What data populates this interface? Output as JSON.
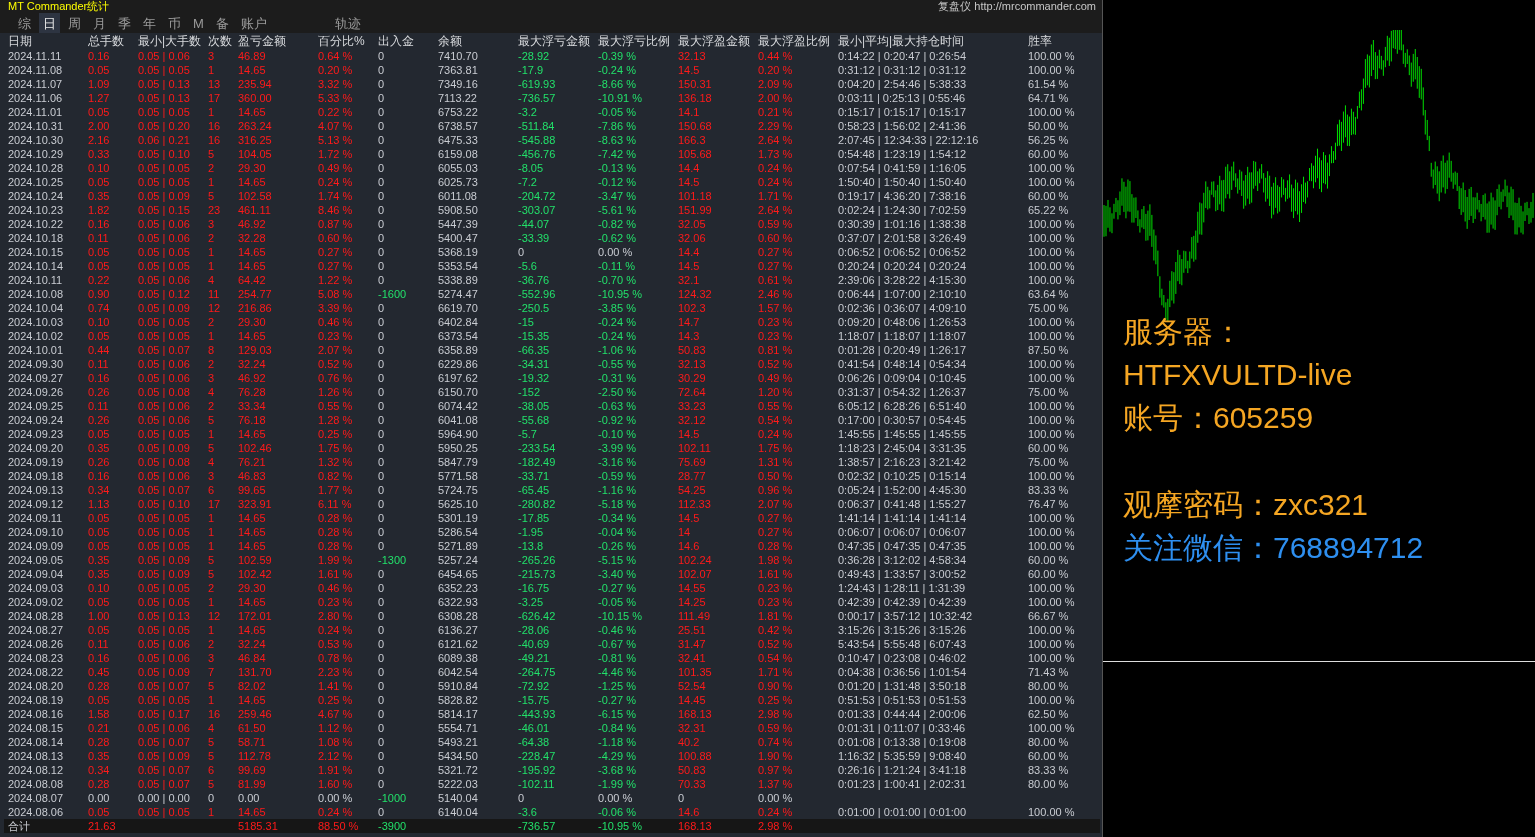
{
  "window": {
    "title": "MT Commander统计",
    "link": "复盘仪 http://mrcommander.com"
  },
  "tabs": [
    {
      "label": "综",
      "selected": false
    },
    {
      "label": "日",
      "selected": true
    },
    {
      "label": "周",
      "selected": false
    },
    {
      "label": "月",
      "selected": false
    },
    {
      "label": "季",
      "selected": false
    },
    {
      "label": "年",
      "selected": false
    },
    {
      "label": "币",
      "selected": false
    },
    {
      "label": "M",
      "selected": false
    },
    {
      "label": "备",
      "selected": false
    },
    {
      "label": "账户",
      "selected": false
    }
  ],
  "trail_tab": {
    "label": "轨迹",
    "selected": false
  },
  "table": {
    "columns": [
      "日期",
      "总手数",
      "最小|大手数",
      "次数",
      "盈亏金额",
      "百分比%",
      "出入金",
      "余额",
      "最大浮亏金额",
      "最大浮亏比例",
      "最大浮盈金额",
      "最大浮盈比例",
      "最小|平均|最大持仓时间",
      "胜率"
    ],
    "rows": [
      {
        "cells": [
          "2024.11.11",
          "0.16",
          "0.05 | 0.06",
          "3",
          "46.89",
          "0.64 %",
          "0",
          "7410.70",
          "-28.92",
          "-0.39 %",
          "32.13",
          "0.44 %",
          "0:14:22 | 0:20:47 | 0:26:54",
          "100.00 %"
        ],
        "trading": true,
        "deposit": false,
        "float_loss": true
      },
      {
        "cells": [
          "2024.11.08",
          "0.05",
          "0.05 | 0.05",
          "1",
          "14.65",
          "0.20 %",
          "0",
          "7363.81",
          "-17.9",
          "-0.24 %",
          "14.5",
          "0.20 %",
          "0:31:12 | 0:31:12 | 0:31:12",
          "100.00 %"
        ],
        "trading": true,
        "deposit": false,
        "float_loss": true
      },
      {
        "cells": [
          "2024.11.07",
          "1.09",
          "0.05 | 0.13",
          "13",
          "235.94",
          "3.32 %",
          "0",
          "7349.16",
          "-619.93",
          "-8.66 %",
          "150.31",
          "2.09 %",
          "0:04:20 | 2:54:46 | 5:38:33",
          "61.54 %"
        ],
        "trading": true,
        "deposit": false,
        "float_loss": true
      },
      {
        "cells": [
          "2024.11.06",
          "1.27",
          "0.05 | 0.13",
          "17",
          "360.00",
          "5.33 %",
          "0",
          "7113.22",
          "-736.57",
          "-10.91 %",
          "136.18",
          "2.00 %",
          "0:03:11 | 0:25:13 | 0:55:46",
          "64.71 %"
        ],
        "trading": true,
        "deposit": false,
        "float_loss": true
      },
      {
        "cells": [
          "2024.11.01",
          "0.05",
          "0.05 | 0.05",
          "1",
          "14.65",
          "0.22 %",
          "0",
          "6753.22",
          "-3.2",
          "-0.05 %",
          "14.1",
          "0.21 %",
          "0:15:17 | 0:15:17 | 0:15:17",
          "100.00 %"
        ],
        "trading": true,
        "deposit": false,
        "float_loss": true
      },
      {
        "cells": [
          "2024.10.31",
          "2.00",
          "0.05 | 0.20",
          "16",
          "263.24",
          "4.07 %",
          "0",
          "6738.57",
          "-511.84",
          "-7.86 %",
          "150.68",
          "2.29 %",
          "0:58:23 | 1:56:02 | 2:41:36",
          "50.00 %"
        ],
        "trading": true,
        "deposit": false,
        "float_loss": true
      },
      {
        "cells": [
          "2024.10.30",
          "2.16",
          "0.06 | 0.21",
          "16",
          "316.25",
          "5.13 %",
          "0",
          "6475.33",
          "-545.88",
          "-8.63 %",
          "166.3",
          "2.64 %",
          "2:07:45 | 12:34:33 | 22:12:16",
          "56.25 %"
        ],
        "trading": true,
        "deposit": false,
        "float_loss": true
      },
      {
        "cells": [
          "2024.10.29",
          "0.33",
          "0.05 | 0.10",
          "5",
          "104.05",
          "1.72 %",
          "0",
          "6159.08",
          "-456.76",
          "-7.42 %",
          "105.68",
          "1.73 %",
          "0:54:48 | 1:23:19 | 1:54:12",
          "60.00 %"
        ],
        "trading": true,
        "deposit": false,
        "float_loss": true
      },
      {
        "cells": [
          "2024.10.28",
          "0.10",
          "0.05 | 0.05",
          "2",
          "29.30",
          "0.49 %",
          "0",
          "6055.03",
          "-8.05",
          "-0.13 %",
          "14.4",
          "0.24 %",
          "0:07:54 | 0:41:59 | 1:16:05",
          "100.00 %"
        ],
        "trading": true,
        "deposit": false,
        "float_loss": true
      },
      {
        "cells": [
          "2024.10.25",
          "0.05",
          "0.05 | 0.05",
          "1",
          "14.65",
          "0.24 %",
          "0",
          "6025.73",
          "-7.2",
          "-0.12 %",
          "14.5",
          "0.24 %",
          "1:50:40 | 1:50:40 | 1:50:40",
          "100.00 %"
        ],
        "trading": true,
        "deposit": false,
        "float_loss": true
      },
      {
        "cells": [
          "2024.10.24",
          "0.35",
          "0.05 | 0.09",
          "5",
          "102.58",
          "1.74 %",
          "0",
          "6011.08",
          "-204.72",
          "-3.47 %",
          "101.18",
          "1.71 %",
          "0:19:17 | 4:36:20 | 7:38:16",
          "60.00 %"
        ],
        "trading": true,
        "deposit": false,
        "float_loss": true
      },
      {
        "cells": [
          "2024.10.23",
          "1.82",
          "0.05 | 0.15",
          "23",
          "461.11",
          "8.46 %",
          "0",
          "5908.50",
          "-303.07",
          "-5.61 %",
          "151.99",
          "2.64 %",
          "0:02:24 | 1:24:30 | 7:02:59",
          "65.22 %"
        ],
        "trading": true,
        "deposit": false,
        "float_loss": true
      },
      {
        "cells": [
          "2024.10.22",
          "0.16",
          "0.05 | 0.06",
          "3",
          "46.92",
          "0.87 %",
          "0",
          "5447.39",
          "-44.07",
          "-0.82 %",
          "32.05",
          "0.59 %",
          "0:30:39 | 1:01:16 | 1:38:38",
          "100.00 %"
        ],
        "trading": true,
        "deposit": false,
        "float_loss": true
      },
      {
        "cells": [
          "2024.10.18",
          "0.11",
          "0.05 | 0.06",
          "2",
          "32.28",
          "0.60 %",
          "0",
          "5400.47",
          "-33.39",
          "-0.62 %",
          "32.06",
          "0.60 %",
          "0:37:07 | 2:01:58 | 3:26:49",
          "100.00 %"
        ],
        "trading": true,
        "deposit": false,
        "float_loss": true
      },
      {
        "cells": [
          "2024.10.15",
          "0.05",
          "0.05 | 0.05",
          "1",
          "14.65",
          "0.27 %",
          "0",
          "5368.19",
          "0",
          "0.00 %",
          "14.4",
          "0.27 %",
          "0:06:52 | 0:06:52 | 0:06:52",
          "100.00 %"
        ],
        "trading": true,
        "deposit": false,
        "float_loss": false
      },
      {
        "cells": [
          "2024.10.14",
          "0.05",
          "0.05 | 0.05",
          "1",
          "14.65",
          "0.27 %",
          "0",
          "5353.54",
          "-5.6",
          "-0.11 %",
          "14.5",
          "0.27 %",
          "0:20:24 | 0:20:24 | 0:20:24",
          "100.00 %"
        ],
        "trading": true,
        "deposit": false,
        "float_loss": true
      },
      {
        "cells": [
          "2024.10.11",
          "0.22",
          "0.05 | 0.06",
          "4",
          "64.42",
          "1.22 %",
          "0",
          "5338.89",
          "-36.76",
          "-0.70 %",
          "32.1",
          "0.61 %",
          "2:39:06 | 3:28:22 | 4:15:30",
          "100.00 %"
        ],
        "trading": true,
        "deposit": false,
        "float_loss": true
      },
      {
        "cells": [
          "2024.10.08",
          "0.90",
          "0.05 | 0.12",
          "11",
          "254.77",
          "5.08 %",
          "-1600",
          "5274.47",
          "-552.96",
          "-10.95 %",
          "124.32",
          "2.46 %",
          "0:06:44 | 1:07:00 | 2:10:10",
          "63.64 %"
        ],
        "trading": true,
        "deposit": true,
        "float_loss": true
      },
      {
        "cells": [
          "2024.10.04",
          "0.74",
          "0.05 | 0.09",
          "12",
          "216.86",
          "3.39 %",
          "0",
          "6619.70",
          "-250.5",
          "-3.85 %",
          "102.3",
          "1.57 %",
          "0:02:36 | 0:36:07 | 4:09:10",
          "75.00 %"
        ],
        "trading": true,
        "deposit": false,
        "float_loss": true
      },
      {
        "cells": [
          "2024.10.03",
          "0.10",
          "0.05 | 0.05",
          "2",
          "29.30",
          "0.46 %",
          "0",
          "6402.84",
          "-15",
          "-0.24 %",
          "14.7",
          "0.23 %",
          "0:09:20 | 0:48:06 | 1:26:53",
          "100.00 %"
        ],
        "trading": true,
        "deposit": false,
        "float_loss": true
      },
      {
        "cells": [
          "2024.10.02",
          "0.05",
          "0.05 | 0.05",
          "1",
          "14.65",
          "0.23 %",
          "0",
          "6373.54",
          "-15.35",
          "-0.24 %",
          "14.3",
          "0.23 %",
          "1:18:07 | 1:18:07 | 1:18:07",
          "100.00 %"
        ],
        "trading": true,
        "deposit": false,
        "float_loss": true
      },
      {
        "cells": [
          "2024.10.01",
          "0.44",
          "0.05 | 0.07",
          "8",
          "129.03",
          "2.07 %",
          "0",
          "6358.89",
          "-66.35",
          "-1.06 %",
          "50.83",
          "0.81 %",
          "0:01:28 | 0:20:49 | 1:26:17",
          "87.50 %"
        ],
        "trading": true,
        "deposit": false,
        "float_loss": true
      },
      {
        "cells": [
          "2024.09.30",
          "0.11",
          "0.05 | 0.06",
          "2",
          "32.24",
          "0.52 %",
          "0",
          "6229.86",
          "-34.31",
          "-0.55 %",
          "32.13",
          "0.52 %",
          "0:41:54 | 0:48:14 | 0:54:34",
          "100.00 %"
        ],
        "trading": true,
        "deposit": false,
        "float_loss": true
      },
      {
        "cells": [
          "2024.09.27",
          "0.16",
          "0.05 | 0.06",
          "3",
          "46.92",
          "0.76 %",
          "0",
          "6197.62",
          "-19.32",
          "-0.31 %",
          "30.29",
          "0.49 %",
          "0:06:26 | 0:09:04 | 0:10:45",
          "100.00 %"
        ],
        "trading": true,
        "deposit": false,
        "float_loss": true
      },
      {
        "cells": [
          "2024.09.26",
          "0.26",
          "0.05 | 0.08",
          "4",
          "76.28",
          "1.26 %",
          "0",
          "6150.70",
          "-152",
          "-2.50 %",
          "72.64",
          "1.20 %",
          "0:31:37 | 0:54:32 | 1:26:37",
          "75.00 %"
        ],
        "trading": true,
        "deposit": false,
        "float_loss": true
      },
      {
        "cells": [
          "2024.09.25",
          "0.11",
          "0.05 | 0.06",
          "2",
          "33.34",
          "0.55 %",
          "0",
          "6074.42",
          "-38.05",
          "-0.63 %",
          "33.23",
          "0.55 %",
          "6:05:12 | 6:28:26 | 6:51:40",
          "100.00 %"
        ],
        "trading": true,
        "deposit": false,
        "float_loss": true
      },
      {
        "cells": [
          "2024.09.24",
          "0.26",
          "0.05 | 0.06",
          "5",
          "76.18",
          "1.28 %",
          "0",
          "6041.08",
          "-55.68",
          "-0.92 %",
          "32.12",
          "0.54 %",
          "0:17:00 | 0:30:57 | 0:54:45",
          "100.00 %"
        ],
        "trading": true,
        "deposit": false,
        "float_loss": true
      },
      {
        "cells": [
          "2024.09.23",
          "0.05",
          "0.05 | 0.05",
          "1",
          "14.65",
          "0.25 %",
          "0",
          "5964.90",
          "-5.7",
          "-0.10 %",
          "14.5",
          "0.24 %",
          "1:45:55 | 1:45:55 | 1:45:55",
          "100.00 %"
        ],
        "trading": true,
        "deposit": false,
        "float_loss": true
      },
      {
        "cells": [
          "2024.09.20",
          "0.35",
          "0.05 | 0.09",
          "5",
          "102.46",
          "1.75 %",
          "0",
          "5950.25",
          "-233.54",
          "-3.99 %",
          "102.11",
          "1.75 %",
          "1:18:23 | 2:45:04 | 3:31:35",
          "60.00 %"
        ],
        "trading": true,
        "deposit": false,
        "float_loss": true
      },
      {
        "cells": [
          "2024.09.19",
          "0.26",
          "0.05 | 0.08",
          "4",
          "76.21",
          "1.32 %",
          "0",
          "5847.79",
          "-182.49",
          "-3.16 %",
          "75.69",
          "1.31 %",
          "1:38:57 | 2:16:23 | 3:21:42",
          "75.00 %"
        ],
        "trading": true,
        "deposit": false,
        "float_loss": true
      },
      {
        "cells": [
          "2024.09.18",
          "0.16",
          "0.05 | 0.06",
          "3",
          "46.83",
          "0.82 %",
          "0",
          "5771.58",
          "-33.71",
          "-0.59 %",
          "28.77",
          "0.50 %",
          "0:02:32 | 0:10:25 | 0:15:14",
          "100.00 %"
        ],
        "trading": true,
        "deposit": false,
        "float_loss": true
      },
      {
        "cells": [
          "2024.09.13",
          "0.34",
          "0.05 | 0.07",
          "6",
          "99.65",
          "1.77 %",
          "0",
          "5724.75",
          "-65.45",
          "-1.16 %",
          "54.25",
          "0.96 %",
          "0:05:24 | 1:52:00 | 4:45:30",
          "83.33 %"
        ],
        "trading": true,
        "deposit": false,
        "float_loss": true
      },
      {
        "cells": [
          "2024.09.12",
          "1.13",
          "0.05 | 0.10",
          "17",
          "323.91",
          "6.11 %",
          "0",
          "5625.10",
          "-280.82",
          "-5.18 %",
          "112.33",
          "2.07 %",
          "0:06:37 | 0:41:48 | 1:55:27",
          "76.47 %"
        ],
        "trading": true,
        "deposit": false,
        "float_loss": true
      },
      {
        "cells": [
          "2024.09.11",
          "0.05",
          "0.05 | 0.05",
          "1",
          "14.65",
          "0.28 %",
          "0",
          "5301.19",
          "-17.85",
          "-0.34 %",
          "14.5",
          "0.27 %",
          "1:41:14 | 1:41:14 | 1:41:14",
          "100.00 %"
        ],
        "trading": true,
        "deposit": false,
        "float_loss": true
      },
      {
        "cells": [
          "2024.09.10",
          "0.05",
          "0.05 | 0.05",
          "1",
          "14.65",
          "0.28 %",
          "0",
          "5286.54",
          "-1.95",
          "-0.04 %",
          "14",
          "0.27 %",
          "0:06:07 | 0:06:07 | 0:06:07",
          "100.00 %"
        ],
        "trading": true,
        "deposit": false,
        "float_loss": true
      },
      {
        "cells": [
          "2024.09.09",
          "0.05",
          "0.05 | 0.05",
          "1",
          "14.65",
          "0.28 %",
          "0",
          "5271.89",
          "-13.8",
          "-0.26 %",
          "14.6",
          "0.28 %",
          "0:47:35 | 0:47:35 | 0:47:35",
          "100.00 %"
        ],
        "trading": true,
        "deposit": false,
        "float_loss": true
      },
      {
        "cells": [
          "2024.09.05",
          "0.35",
          "0.05 | 0.09",
          "5",
          "102.59",
          "1.99 %",
          "-1300",
          "5257.24",
          "-265.26",
          "-5.15 %",
          "102.24",
          "1.98 %",
          "0:36:28 | 3:12:02 | 4:58:34",
          "60.00 %"
        ],
        "trading": true,
        "deposit": true,
        "float_loss": true
      },
      {
        "cells": [
          "2024.09.04",
          "0.35",
          "0.05 | 0.09",
          "5",
          "102.42",
          "1.61 %",
          "0",
          "6454.65",
          "-215.73",
          "-3.40 %",
          "102.07",
          "1.61 %",
          "0:49:43 | 1:33:57 | 3:00:52",
          "60.00 %"
        ],
        "trading": true,
        "deposit": false,
        "float_loss": true
      },
      {
        "cells": [
          "2024.09.03",
          "0.10",
          "0.05 | 0.05",
          "2",
          "29.30",
          "0.46 %",
          "0",
          "6352.23",
          "-16.75",
          "-0.27 %",
          "14.55",
          "0.23 %",
          "1:24:43 | 1:28:11 | 1:31:39",
          "100.00 %"
        ],
        "trading": true,
        "deposit": false,
        "float_loss": true
      },
      {
        "cells": [
          "2024.09.02",
          "0.05",
          "0.05 | 0.05",
          "1",
          "14.65",
          "0.23 %",
          "0",
          "6322.93",
          "-3.25",
          "-0.05 %",
          "14.25",
          "0.23 %",
          "0:42:39 | 0:42:39 | 0:42:39",
          "100.00 %"
        ],
        "trading": true,
        "deposit": false,
        "float_loss": true
      },
      {
        "cells": [
          "2024.08.28",
          "1.00",
          "0.05 | 0.13",
          "12",
          "172.01",
          "2.80 %",
          "0",
          "6308.28",
          "-626.42",
          "-10.15 %",
          "111.49",
          "1.81 %",
          "0:00:17 | 3:57:12 | 10:32:42",
          "66.67 %"
        ],
        "trading": true,
        "deposit": false,
        "float_loss": true
      },
      {
        "cells": [
          "2024.08.27",
          "0.05",
          "0.05 | 0.05",
          "1",
          "14.65",
          "0.24 %",
          "0",
          "6136.27",
          "-28.06",
          "-0.46 %",
          "25.51",
          "0.42 %",
          "3:15:26 | 3:15:26 | 3:15:26",
          "100.00 %"
        ],
        "trading": true,
        "deposit": false,
        "float_loss": true
      },
      {
        "cells": [
          "2024.08.26",
          "0.11",
          "0.05 | 0.06",
          "2",
          "32.24",
          "0.53 %",
          "0",
          "6121.62",
          "-40.69",
          "-0.67 %",
          "31.47",
          "0.52 %",
          "5:43:54 | 5:55:48 | 6:07:43",
          "100.00 %"
        ],
        "trading": true,
        "deposit": false,
        "float_loss": true
      },
      {
        "cells": [
          "2024.08.23",
          "0.16",
          "0.05 | 0.06",
          "3",
          "46.84",
          "0.78 %",
          "0",
          "6089.38",
          "-49.21",
          "-0.81 %",
          "32.41",
          "0.54 %",
          "0:10:47 | 0:23:08 | 0:46:02",
          "100.00 %"
        ],
        "trading": true,
        "deposit": false,
        "float_loss": true
      },
      {
        "cells": [
          "2024.08.22",
          "0.45",
          "0.05 | 0.09",
          "7",
          "131.70",
          "2.23 %",
          "0",
          "6042.54",
          "-264.75",
          "-4.46 %",
          "101.35",
          "1.71 %",
          "0:04:38 | 0:36:56 | 1:01:54",
          "71.43 %"
        ],
        "trading": true,
        "deposit": false,
        "float_loss": true
      },
      {
        "cells": [
          "2024.08.20",
          "0.28",
          "0.05 | 0.07",
          "5",
          "82.02",
          "1.41 %",
          "0",
          "5910.84",
          "-72.92",
          "-1.25 %",
          "52.54",
          "0.90 %",
          "0:01:20 | 1:31:48 | 3:50:18",
          "80.00 %"
        ],
        "trading": true,
        "deposit": false,
        "float_loss": true
      },
      {
        "cells": [
          "2024.08.19",
          "0.05",
          "0.05 | 0.05",
          "1",
          "14.65",
          "0.25 %",
          "0",
          "5828.82",
          "-15.75",
          "-0.27 %",
          "14.45",
          "0.25 %",
          "0:51:53 | 0:51:53 | 0:51:53",
          "100.00 %"
        ],
        "trading": true,
        "deposit": false,
        "float_loss": true
      },
      {
        "cells": [
          "2024.08.16",
          "1.58",
          "0.05 | 0.17",
          "16",
          "259.46",
          "4.67 %",
          "0",
          "5814.17",
          "-443.93",
          "-6.15 %",
          "168.13",
          "2.98 %",
          "0:01:33 | 0:44:44 | 2:00:06",
          "62.50 %"
        ],
        "trading": true,
        "deposit": false,
        "float_loss": true
      },
      {
        "cells": [
          "2024.08.15",
          "0.21",
          "0.05 | 0.06",
          "4",
          "61.50",
          "1.12 %",
          "0",
          "5554.71",
          "-46.01",
          "-0.84 %",
          "32.31",
          "0.59 %",
          "0:01:31 | 0:11:07 | 0:33:46",
          "100.00 %"
        ],
        "trading": true,
        "deposit": false,
        "float_loss": true
      },
      {
        "cells": [
          "2024.08.14",
          "0.28",
          "0.05 | 0.07",
          "5",
          "58.71",
          "1.08 %",
          "0",
          "5493.21",
          "-64.38",
          "-1.18 %",
          "40.2",
          "0.74 %",
          "0:01:08 | 0:13:38 | 0:19:08",
          "80.00 %"
        ],
        "trading": true,
        "deposit": false,
        "float_loss": true
      },
      {
        "cells": [
          "2024.08.13",
          "0.35",
          "0.05 | 0.09",
          "5",
          "112.78",
          "2.12 %",
          "0",
          "5434.50",
          "-228.47",
          "-4.29 %",
          "100.88",
          "1.90 %",
          "1:16:32 | 5:35:59 | 9:08:40",
          "60.00 %"
        ],
        "trading": true,
        "deposit": false,
        "float_loss": true
      },
      {
        "cells": [
          "2024.08.12",
          "0.34",
          "0.05 | 0.07",
          "6",
          "99.69",
          "1.91 %",
          "0",
          "5321.72",
          "-195.92",
          "-3.68 %",
          "50.83",
          "0.97 %",
          "0:26:16 | 1:21:24 | 3:41:18",
          "83.33 %"
        ],
        "trading": true,
        "deposit": false,
        "float_loss": true
      },
      {
        "cells": [
          "2024.08.08",
          "0.28",
          "0.05 | 0.07",
          "5",
          "81.99",
          "1.60 %",
          "0",
          "5222.03",
          "-102.11",
          "-1.99 %",
          "70.33",
          "1.37 %",
          "0:01:23 | 1:00:41 | 2:02:31",
          "80.00 %"
        ],
        "trading": true,
        "deposit": false,
        "float_loss": true
      },
      {
        "cells": [
          "2024.08.07",
          "0.00",
          "0.00 | 0.00",
          "0",
          "0.00",
          "0.00 %",
          "-1000",
          "5140.04",
          "0",
          "0.00 %",
          "0",
          "0.00 %"
        ],
        "trading": false,
        "deposit": true,
        "float_loss": false
      },
      {
        "cells": [
          "2024.08.06",
          "0.05",
          "0.05 | 0.05",
          "1",
          "14.65",
          "0.24 %",
          "0",
          "6140.04",
          "-3.6",
          "-0.06 %",
          "14.6",
          "0.24 %",
          "0:01:00 | 0:01:00 | 0:01:00",
          "100.00 %"
        ],
        "trading": true,
        "deposit": false,
        "float_loss": true
      }
    ],
    "total": {
      "label": "合计",
      "lots": "21.63",
      "profit": "5185.31",
      "percent": "88.50 %",
      "deposit": "-3900",
      "float_loss": "-736.57",
      "float_loss_pct": "-10.95 %",
      "float_profit": "168.13",
      "float_profit_pct": "2.98 %"
    }
  },
  "info": [
    [
      {
        "text": "服务器：",
        "color": "#f5a623"
      },
      {
        "text": "HTFXVULTD-live",
        "color": "#f5a623"
      },
      {
        "text": "账号：605259",
        "color": "#f5a623"
      }
    ],
    [
      {
        "text": "观摩密码：zxc321",
        "color": "#f5a623"
      },
      {
        "text": "关注微信：768894712",
        "color": "#2e8ff0"
      }
    ]
  ]
}
